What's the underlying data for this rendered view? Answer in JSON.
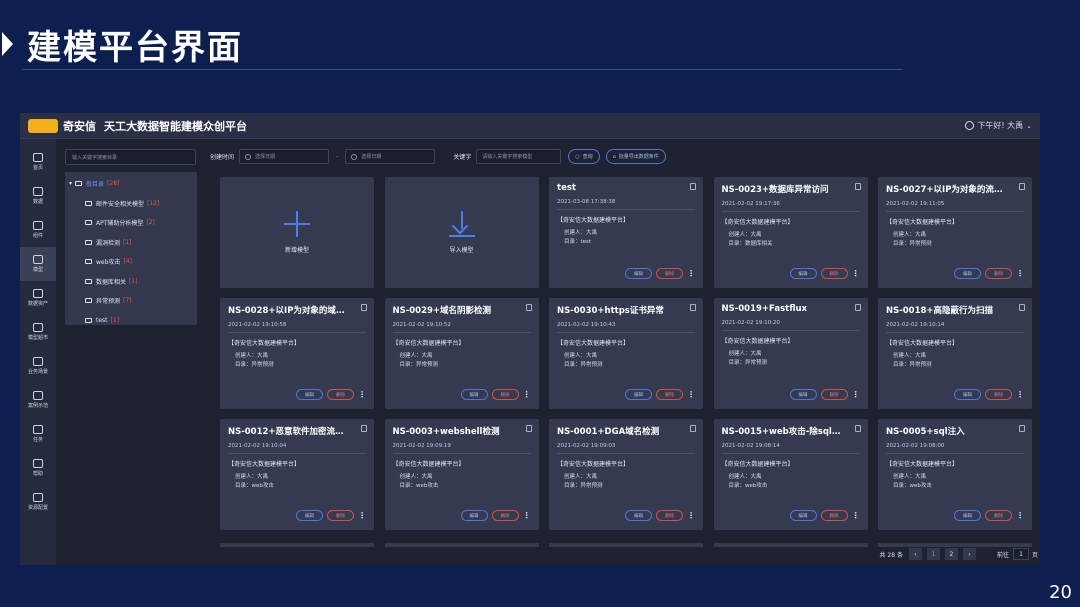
{
  "slide": {
    "title": "建模平台界面",
    "page_number": "20"
  },
  "app": {
    "brand": "奇安信",
    "platform_name": "天工大数据智能建模众创平台",
    "greeting": "下午好! 大禹"
  },
  "nav": [
    {
      "label": "首页",
      "icon": "home-icon"
    },
    {
      "label": "数据",
      "icon": "database-icon"
    },
    {
      "label": "组件",
      "icon": "layers-icon"
    },
    {
      "label": "模型",
      "icon": "grid-icon",
      "active": true
    },
    {
      "label": "数据资产",
      "icon": "assets-icon"
    },
    {
      "label": "模型超市",
      "icon": "market-icon"
    },
    {
      "label": "业务场景",
      "icon": "scene-icon"
    },
    {
      "label": "案例示范",
      "icon": "case-icon"
    },
    {
      "label": "任务",
      "icon": "task-icon"
    },
    {
      "label": "帮助",
      "icon": "help-icon"
    },
    {
      "label": "资源配置",
      "icon": "settings-icon"
    }
  ],
  "tree": {
    "search_placeholder": "输入关键字搜索目录",
    "root": {
      "label": "根目录",
      "count": "[28]"
    },
    "children": [
      {
        "label": "邮件安全相关模型",
        "count": "[12]"
      },
      {
        "label": "APT辅助分析模型",
        "count": "[2]"
      },
      {
        "label": "漏洞检测",
        "count": "[1]"
      },
      {
        "label": "web攻击",
        "count": "[4]"
      },
      {
        "label": "数据库相关",
        "count": "[1]"
      },
      {
        "label": "异常预测",
        "count": "[7]"
      },
      {
        "label": "test",
        "count": "[1]"
      }
    ]
  },
  "filters": {
    "created_time_label": "创建时间",
    "start_placeholder": "选择日期",
    "separator": "-",
    "end_placeholder": "选择日期",
    "keyword_label": "关键字",
    "keyword_placeholder": "请输入关键字搜索模型",
    "search_button": "查询",
    "batch_button": "批量导出数据条件"
  },
  "actions": {
    "new_model": "新增模型",
    "import_model": "导入模型"
  },
  "card_labels": {
    "creator_prefix": "创建人：",
    "dir_prefix": "目录：",
    "edit": "编辑",
    "delete": "删除"
  },
  "cards": [
    {
      "title": "test",
      "date": "2021-03-08 17:38:38",
      "platform": "【奇安信大数据建模平台】",
      "creator": "大禹",
      "dir": "test"
    },
    {
      "title": "NS-0023+数据库异常访问",
      "date": "2021-02-02 19:17:36",
      "platform": "【奇安信大数据建模平台】",
      "creator": "大禹",
      "dir": "数据库相关"
    },
    {
      "title": "NS-0027+以IP为对象的流量统计",
      "date": "2021-02-02 19:11:05",
      "platform": "【奇安信大数据建模平台】",
      "creator": "大禹",
      "dir": "异常预测"
    },
    {
      "title": "NS-0028+以IP为对象的域名访问",
      "date": "2021-02-02 19:10:58",
      "platform": "【奇安信大数据建模平台】",
      "creator": "大禹",
      "dir": "异常预测"
    },
    {
      "title": "NS-0029+域名阴影检测",
      "date": "2021-02-02 19:10:52",
      "platform": "【奇安信大数据建模平台】",
      "creator": "大禹",
      "dir": "异常预测"
    },
    {
      "title": "NS-0030+https证书异常",
      "date": "2021-02-02 19:10:43",
      "platform": "【奇安信大数据建模平台】",
      "creator": "大禹",
      "dir": "异常预测"
    },
    {
      "title": "NS-0019+Fastflux",
      "date": "2021-02-02 19:10:20",
      "platform": "【奇安信大数据建模平台】",
      "creator": "大禹",
      "dir": "异常预测"
    },
    {
      "title": "NS-0018+高隐蔽行为扫描",
      "date": "2021-02-02 19:10:14",
      "platform": "【奇安信大数据建模平台】",
      "creator": "大禹",
      "dir": "异常预测"
    },
    {
      "title": "NS-0012+恶意软件加密流量检测",
      "date": "2021-02-02 19:10:04",
      "platform": "【奇安信大数据建模平台】",
      "creator": "大禹",
      "dir": "web攻击"
    },
    {
      "title": "NS-0003+webshell检测",
      "date": "2021-02-02 19:09:19",
      "platform": "【奇安信大数据建模平台】",
      "creator": "大禹",
      "dir": "web攻击"
    },
    {
      "title": "NS-0001+DGA域名检测",
      "date": "2021-02-02 19:09:03",
      "platform": "【奇安信大数据建模平台】",
      "creator": "大禹",
      "dir": "异常预测"
    },
    {
      "title": "NS-0015+web攻击-除sql注入",
      "date": "2021-02-02 19:08:14",
      "platform": "【奇安信大数据建模平台】",
      "creator": "大禹",
      "dir": "web攻击"
    },
    {
      "title": "NS-0005+sql注入",
      "date": "2021-02-02 19:08:00",
      "platform": "【奇安信大数据建模平台】",
      "creator": "大禹",
      "dir": "web攻击"
    }
  ],
  "pager": {
    "total": "共 28 条",
    "prev": "‹",
    "pages": [
      "1",
      "2"
    ],
    "current": "1",
    "next": "›",
    "goto_label": "前往",
    "goto_value": "1",
    "page_suffix": "页"
  }
}
